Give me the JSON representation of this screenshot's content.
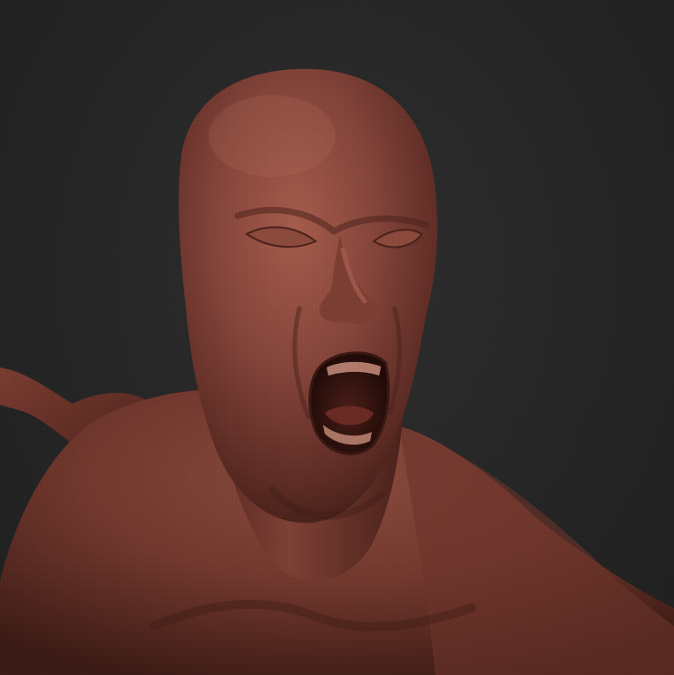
{
  "scene": {
    "subject": "sculpt-bust",
    "colors": {
      "background": "#262626",
      "clay_base": "#7a3f33",
      "clay_light": "#a25a4a",
      "clay_dark": "#3e1c16",
      "mouth_interior": "#2a0f0c",
      "teeth": "#c98e7c"
    }
  }
}
